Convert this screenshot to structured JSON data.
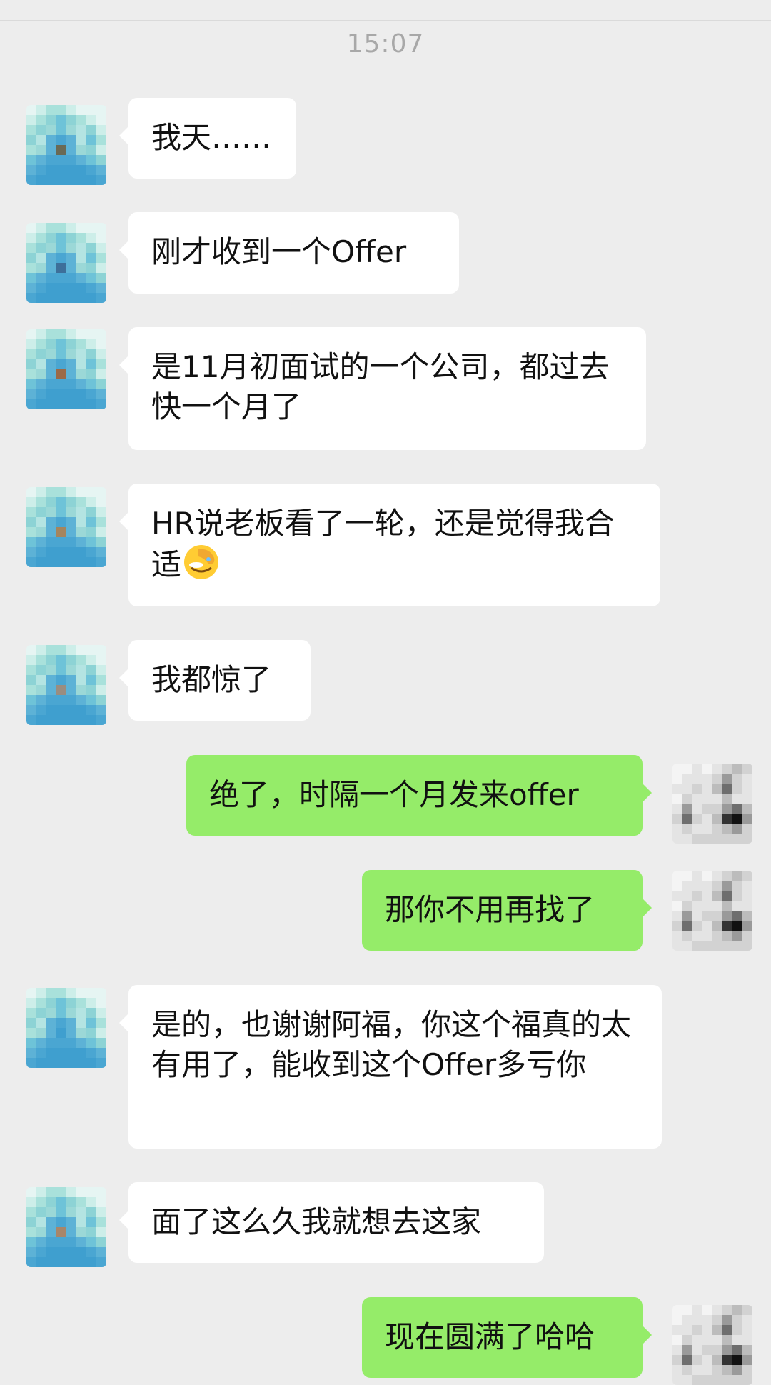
{
  "chat": {
    "timestamp": "15:07",
    "colors": {
      "background": "#ededed",
      "incoming_bubble": "#ffffff",
      "outgoing_bubble": "#95ec69",
      "timestamp_text": "#a8a8a8"
    },
    "messages": [
      {
        "from": "other",
        "text": "我天……"
      },
      {
        "from": "other",
        "text": "刚才收到一个Offer"
      },
      {
        "from": "other",
        "text": "是11月初面试的一个公司，都过去快一个月了"
      },
      {
        "from": "other",
        "text": "HR说老板看了一轮，还是觉得我合适",
        "emoji": "facepalm-emoji"
      },
      {
        "from": "other",
        "text": "我都惊了"
      },
      {
        "from": "me",
        "text": "绝了，时隔一个月发来offer"
      },
      {
        "from": "me",
        "text": "那你不用再找了"
      },
      {
        "from": "other",
        "text": "是的，也谢谢阿福，你这个福真的太有用了，能收到这个Offer多亏你"
      },
      {
        "from": "other",
        "text": "面了这么久我就想去这家"
      },
      {
        "from": "me",
        "text": "现在圆满了哈哈"
      }
    ]
  }
}
